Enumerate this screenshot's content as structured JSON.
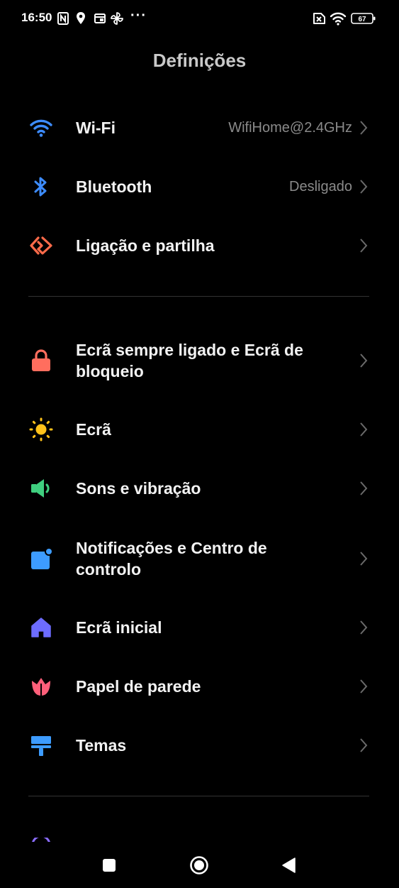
{
  "status_bar": {
    "time": "16:50",
    "left_icons": [
      "nfc-icon",
      "location-icon",
      "screen-cast-icon",
      "pinwheel-icon"
    ],
    "more": "···",
    "right_icons": [
      "no-sim-icon",
      "wifi-signal-icon",
      "battery-icon"
    ],
    "battery_level": "67"
  },
  "header": {
    "title": "Definições"
  },
  "sections": [
    {
      "items": [
        {
          "label": "Wi-Fi",
          "value": "WifiHome@2.4GHz",
          "icon": "wifi-icon",
          "color": "#3d8cff"
        },
        {
          "label": "Bluetooth",
          "value": "Desligado",
          "icon": "bluetooth-icon",
          "color": "#3d8cff"
        },
        {
          "label": "Ligação e partilha",
          "value": "",
          "icon": "connection-sharing-icon",
          "color": "#ff6b4a"
        }
      ]
    },
    {
      "items": [
        {
          "label": "Ecrã sempre ligado e Ecrã de bloqueio",
          "value": "",
          "icon": "lock-icon",
          "color": "#ff6e5e"
        },
        {
          "label": "Ecrã",
          "value": "",
          "icon": "sun-icon",
          "color": "#ffc21a"
        },
        {
          "label": "Sons e vibração",
          "value": "",
          "icon": "speaker-icon",
          "color": "#3fcf7f"
        },
        {
          "label": "Notificações e Centro de controlo",
          "value": "",
          "icon": "notification-icon",
          "color": "#3d9cff"
        },
        {
          "label": "Ecrã inicial",
          "value": "",
          "icon": "home-icon",
          "color": "#6d6cff"
        },
        {
          "label": "Papel de parede",
          "value": "",
          "icon": "tulip-icon",
          "color": "#ff5f7a"
        },
        {
          "label": "Temas",
          "value": "",
          "icon": "paint-roller-icon",
          "color": "#3d9cff"
        }
      ]
    }
  ],
  "nav_bar": {
    "buttons": [
      "recents-button",
      "home-button",
      "back-button"
    ]
  }
}
